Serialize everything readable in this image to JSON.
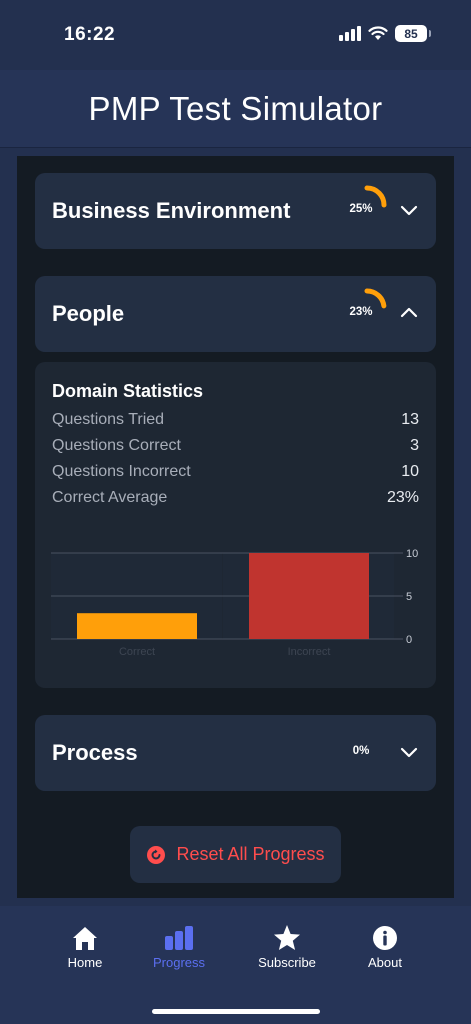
{
  "status_bar": {
    "time": "16:22",
    "battery": "85"
  },
  "header": {
    "title": "PMP Test Simulator"
  },
  "domains": [
    {
      "name": "Business Environment",
      "percent_label": "25%",
      "percent": 25,
      "expanded": false
    },
    {
      "name": "People",
      "percent_label": "23%",
      "percent": 23,
      "expanded": true
    },
    {
      "name": "Process",
      "percent_label": "0%",
      "percent": 0,
      "expanded": false
    }
  ],
  "stats": {
    "title": "Domain Statistics",
    "rows": [
      {
        "label": "Questions Tried",
        "value": "13"
      },
      {
        "label": "Questions Correct",
        "value": "3"
      },
      {
        "label": "Questions Incorrect",
        "value": "10"
      },
      {
        "label": "Correct Average",
        "value": "23%"
      }
    ]
  },
  "chart_data": {
    "type": "bar",
    "categories": [
      "Correct",
      "Incorrect"
    ],
    "values": [
      3,
      10
    ],
    "colors": [
      "#ff9f0a",
      "#c0342f"
    ],
    "ylim": [
      0,
      10
    ],
    "yticks": [
      0,
      5,
      10
    ],
    "y_axis_position": "right",
    "grid": true
  },
  "reset": {
    "label": "Reset All Progress"
  },
  "tabs": [
    {
      "label": "Home",
      "icon": "home-icon",
      "active": false
    },
    {
      "label": "Progress",
      "icon": "bar-chart-icon",
      "active": true
    },
    {
      "label": "Subscribe",
      "icon": "star-icon",
      "active": false
    },
    {
      "label": "About",
      "icon": "info-icon",
      "active": false
    }
  ],
  "colors": {
    "accent": "#5b6ff0",
    "gauge": "#ff9f0a",
    "danger": "#ff4d4d"
  }
}
